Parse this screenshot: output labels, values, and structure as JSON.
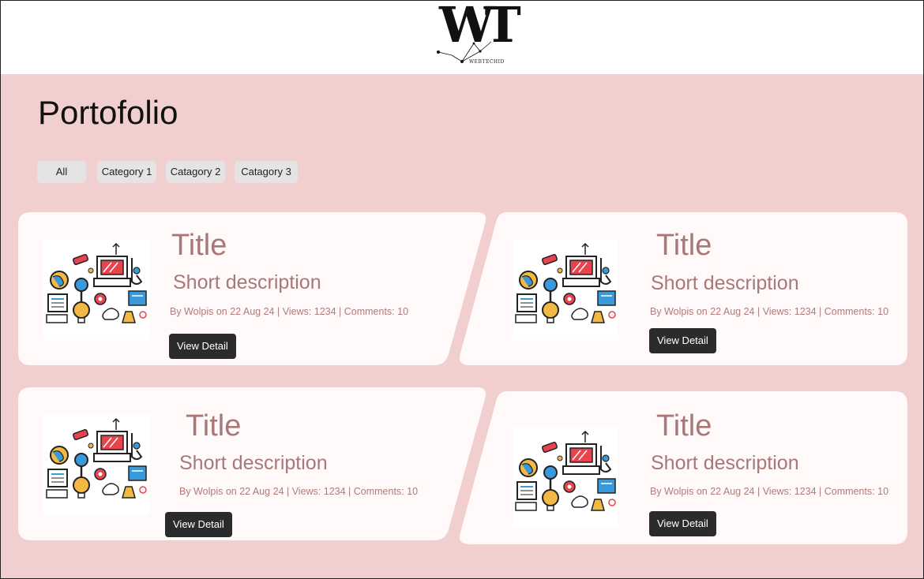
{
  "brand": {
    "logo_letters": "WT",
    "logo_sub": "WEBTECHID"
  },
  "page": {
    "title": "Portofolio"
  },
  "filters": [
    "All",
    "Category 1",
    "Catagory 2",
    "Catagory 3"
  ],
  "cards": [
    {
      "title": "Title",
      "description": "Short description",
      "meta": "By Wolpis on 22 Aug 24 | Views: 1234 | Comments: 10",
      "button": "View Detail"
    },
    {
      "title": "Title",
      "description": "Short description",
      "meta": "By Wolpis on 22 Aug 24 | Views: 1234 | Comments: 10",
      "button": "View Detail"
    },
    {
      "title": "Title",
      "description": "Short description",
      "meta": "By Wolpis on 22 Aug 24 | Views: 1234 | Comments: 10",
      "button": "View Detail"
    },
    {
      "title": "Title",
      "description": "Short description",
      "meta": "By Wolpis on 22 Aug 24 | Views: 1234 | Comments: 10",
      "button": "View Detail"
    }
  ],
  "colors": {
    "background": "#f1cfcf",
    "card": "#fff9f9",
    "accent_text": "#a87878",
    "button": "#2b2b2b",
    "chip": "#e5e3e3"
  }
}
